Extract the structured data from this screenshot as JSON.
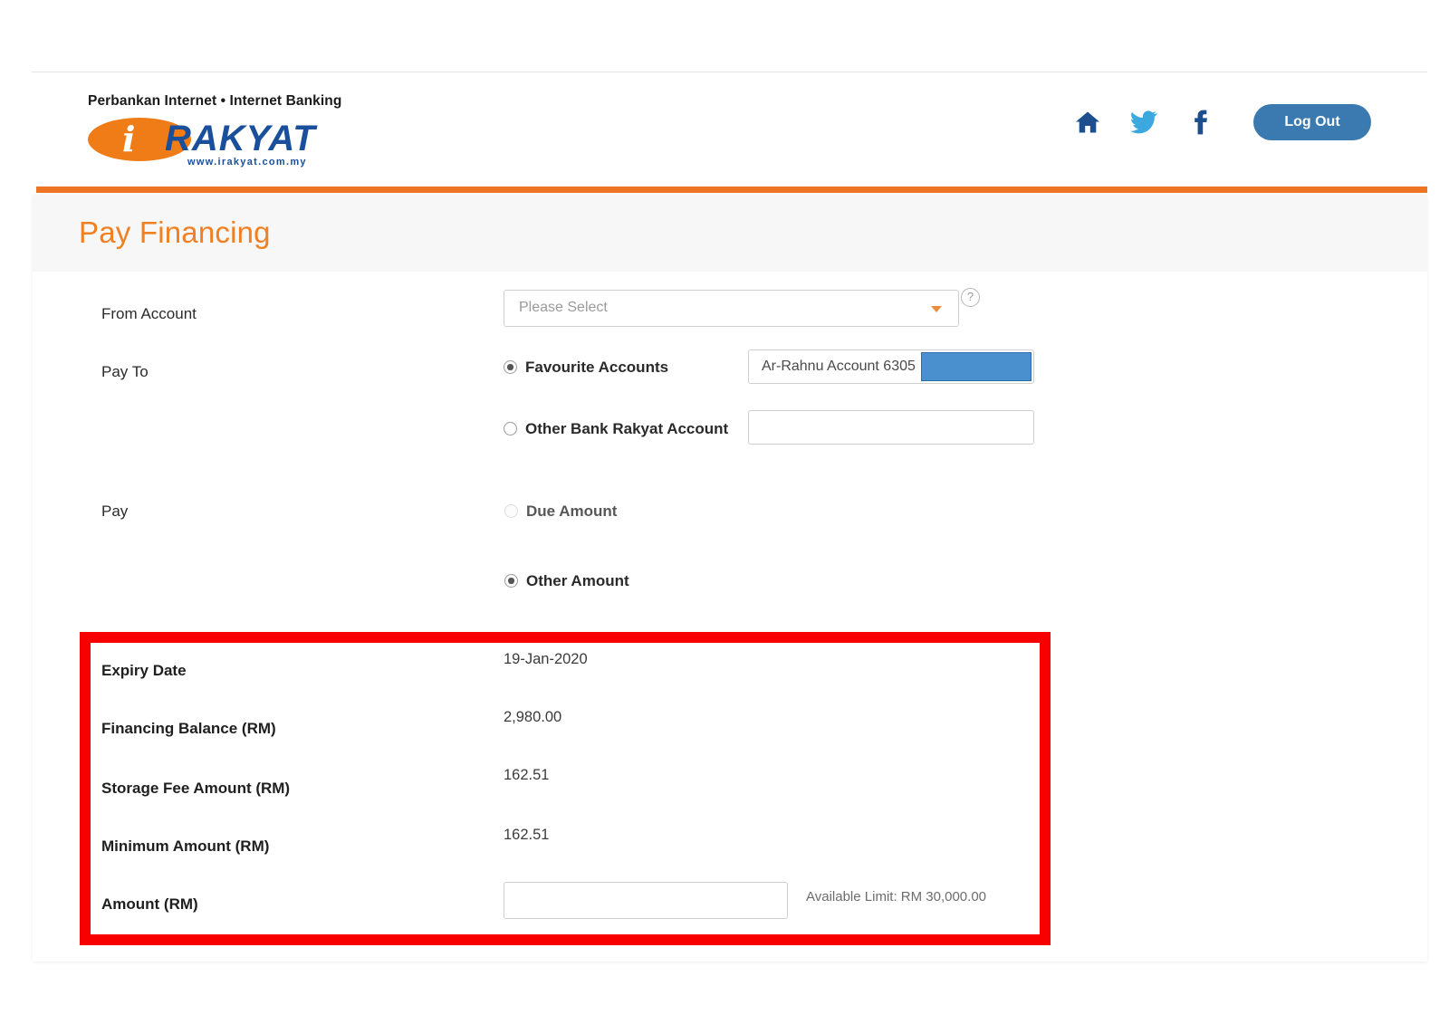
{
  "header": {
    "tagline": "Perbankan Internet • Internet Banking",
    "logo_i": "i",
    "logo_word": "RAKYAT",
    "logo_url": "www.irakyat.com.my",
    "icons": {
      "home": "home-icon",
      "twitter": "twitter-icon",
      "facebook": "facebook-icon"
    },
    "logout_label": "Log Out",
    "doc_icon": "document-menu-icon"
  },
  "page": {
    "title": "Pay Financing"
  },
  "form": {
    "from_account": {
      "label": "From Account",
      "placeholder": "Please Select",
      "value": "",
      "help_icon": "help-circle-icon"
    },
    "pay_to": {
      "label": "Pay To",
      "options": [
        {
          "label": "Favourite Accounts",
          "selected": true,
          "field_value": "Ar-Rahnu Account 6305",
          "redacted": true
        },
        {
          "label": "Other Bank Rakyat Account",
          "selected": false,
          "field_value": "",
          "redacted": false
        }
      ]
    },
    "pay": {
      "label": "Pay",
      "options": [
        {
          "label": "Due Amount",
          "selected": false,
          "disabled": true
        },
        {
          "label": "Other Amount",
          "selected": true,
          "disabled": false
        }
      ]
    },
    "details": [
      {
        "label": "Expiry Date",
        "value": "19-Jan-2020"
      },
      {
        "label": "Financing Balance (RM)",
        "value": "2,980.00"
      },
      {
        "label": "Storage Fee Amount (RM)",
        "value": "162.51"
      },
      {
        "label": "Minimum Amount (RM)",
        "value": "162.51"
      }
    ],
    "amount": {
      "label": "Amount (RM)",
      "value": "",
      "placeholder": "",
      "available_limit": "Available Limit: RM 30,000.00"
    }
  },
  "colors": {
    "brand_orange": "#ec7423",
    "title_orange": "#ef8023",
    "brand_blue": "#1a4f9c",
    "logout_blue": "#3a7ab1",
    "highlight_red": "#f80000",
    "redaction_blue": "#4a8fce"
  }
}
